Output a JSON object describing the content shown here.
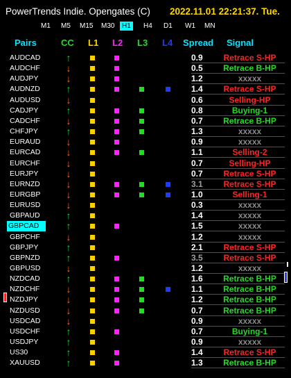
{
  "header": {
    "title": "PowerTrends Indie. Opengates (C)",
    "datetime": "2022.11.01 22:21:37. Tue."
  },
  "timeframes": [
    "M1",
    "M5",
    "M15",
    "M30",
    "H1",
    "H4",
    "D1",
    "W1",
    "MN"
  ],
  "active_timeframe": "H1",
  "columns": {
    "pairs": "Pairs",
    "cc": "CC",
    "l1": "L1",
    "l2": "L2",
    "l3": "L3",
    "l4": "L4",
    "spread": "Spread",
    "signal": "Signal"
  },
  "colors": {
    "up": "#22dd22",
    "down": "#ff6a1a",
    "l1": "#ffd000",
    "l2": "#ff22ff",
    "l3": "#22dd22",
    "l4": "#1e3cff",
    "spread": "#ffffff",
    "spread_dim": "#a0a0a0",
    "retrace_s": "#ff2222",
    "retrace_b": "#22dd22",
    "selling": "#ff2222",
    "buying": "#22dd22",
    "neutral": "#8a8a8a"
  },
  "rows": [
    {
      "pair": "AUDCAD",
      "cc": "up",
      "l1": true,
      "l2": true,
      "l3": false,
      "l4": false,
      "spread": "0.9",
      "signal": "Retrace S-HP",
      "sig": "retrace_s"
    },
    {
      "pair": "AUDCHF",
      "cc": "down",
      "l1": true,
      "l2": true,
      "l3": false,
      "l4": false,
      "spread": "0.5",
      "signal": "Retrace B-HP",
      "sig": "retrace_b"
    },
    {
      "pair": "AUDJPY",
      "cc": "down",
      "l1": true,
      "l2": true,
      "l3": false,
      "l4": false,
      "spread": "1.2",
      "signal": "xxxxx",
      "sig": "neutral"
    },
    {
      "pair": "AUDNZD",
      "cc": "up",
      "l1": true,
      "l2": true,
      "l3": true,
      "l4": true,
      "spread": "1.4",
      "signal": "Retrace S-HP",
      "sig": "retrace_s"
    },
    {
      "pair": "AUDUSD",
      "cc": "down",
      "l1": true,
      "l2": false,
      "l3": false,
      "l4": false,
      "spread": "0.6",
      "signal": "Selling-HP",
      "sig": "selling"
    },
    {
      "pair": "CADJPY",
      "cc": "up",
      "l1": true,
      "l2": true,
      "l3": true,
      "l4": false,
      "spread": "0.8",
      "signal": "Buying-1",
      "sig": "buying"
    },
    {
      "pair": "CADCHF",
      "cc": "down",
      "l1": true,
      "l2": true,
      "l3": true,
      "l4": false,
      "spread": "0.7",
      "signal": "Retrace B-HP",
      "sig": "retrace_b"
    },
    {
      "pair": "CHFJPY",
      "cc": "up",
      "l1": true,
      "l2": true,
      "l3": true,
      "l4": false,
      "spread": "1.3",
      "signal": "xxxxx",
      "sig": "neutral"
    },
    {
      "pair": "EURAUD",
      "cc": "down",
      "l1": true,
      "l2": true,
      "l3": false,
      "l4": false,
      "spread": "0.9",
      "signal": "xxxxx",
      "sig": "neutral"
    },
    {
      "pair": "EURCAD",
      "cc": "down",
      "l1": true,
      "l2": true,
      "l3": true,
      "l4": false,
      "spread": "1.1",
      "signal": "Selling-2",
      "sig": "selling"
    },
    {
      "pair": "EURCHF",
      "cc": "down",
      "l1": true,
      "l2": false,
      "l3": false,
      "l4": false,
      "spread": "0.7",
      "signal": "Selling-HP",
      "sig": "selling"
    },
    {
      "pair": "EURJPY",
      "cc": "down",
      "l1": true,
      "l2": false,
      "l3": false,
      "l4": false,
      "spread": "0.7",
      "signal": "Retrace S-HP",
      "sig": "retrace_s"
    },
    {
      "pair": "EURNZD",
      "cc": "down",
      "l1": true,
      "l2": true,
      "l3": true,
      "l4": true,
      "spread": "3.1",
      "dim": true,
      "signal": "Retrace S-HP",
      "sig": "retrace_s"
    },
    {
      "pair": "EURGBP",
      "cc": "down",
      "l1": true,
      "l2": true,
      "l3": true,
      "l4": true,
      "spread": "1.0",
      "signal": "Selling-1",
      "sig": "selling"
    },
    {
      "pair": "EURUSD",
      "cc": "down",
      "l1": true,
      "l2": false,
      "l3": false,
      "l4": false,
      "spread": "0.3",
      "signal": "xxxxx",
      "sig": "neutral"
    },
    {
      "pair": "GBPAUD",
      "cc": "up",
      "l1": true,
      "l2": false,
      "l3": false,
      "l4": false,
      "spread": "1.4",
      "signal": "xxxxx",
      "sig": "neutral"
    },
    {
      "pair": "GBPCAD",
      "cc": "up",
      "l1": true,
      "l2": true,
      "l3": false,
      "l4": false,
      "spread": "1.5",
      "signal": "xxxxx",
      "sig": "neutral",
      "hl": true
    },
    {
      "pair": "GBPCHF",
      "cc": "down",
      "l1": true,
      "l2": false,
      "l3": false,
      "l4": false,
      "spread": "1.2",
      "signal": "xxxxx",
      "sig": "neutral"
    },
    {
      "pair": "GBPJPY",
      "cc": "up",
      "l1": true,
      "l2": false,
      "l3": false,
      "l4": false,
      "spread": "2.1",
      "signal": "Retrace S-HP",
      "sig": "retrace_s"
    },
    {
      "pair": "GBPNZD",
      "cc": "up",
      "l1": true,
      "l2": true,
      "l3": false,
      "l4": false,
      "spread": "3.5",
      "dim": true,
      "signal": "Retrace S-HP",
      "sig": "retrace_s"
    },
    {
      "pair": "GBPUSD",
      "cc": "down",
      "l1": true,
      "l2": false,
      "l3": false,
      "l4": false,
      "spread": "1.2",
      "signal": "xxxxx",
      "sig": "neutral"
    },
    {
      "pair": "NZDCAD",
      "cc": "up",
      "l1": true,
      "l2": true,
      "l3": true,
      "l4": false,
      "spread": "1.6",
      "signal": "Retrace B-HP",
      "sig": "retrace_b"
    },
    {
      "pair": "NZDCHF",
      "cc": "down",
      "l1": true,
      "l2": true,
      "l3": true,
      "l4": true,
      "spread": "1.1",
      "signal": "Retrace B-HP",
      "sig": "retrace_b"
    },
    {
      "pair": "NZDJPY",
      "cc": "down",
      "l1": true,
      "l2": true,
      "l3": true,
      "l4": false,
      "spread": "1.2",
      "signal": "Retrace B-HP",
      "sig": "retrace_b"
    },
    {
      "pair": "NZDUSD",
      "cc": "down",
      "l1": true,
      "l2": true,
      "l3": true,
      "l4": false,
      "spread": "0.7",
      "signal": "Retrace B-HP",
      "sig": "retrace_b"
    },
    {
      "pair": "USDCAD",
      "cc": "down",
      "l1": true,
      "l2": false,
      "l3": false,
      "l4": false,
      "spread": "0.9",
      "signal": "xxxxx",
      "sig": "neutral"
    },
    {
      "pair": "USDCHF",
      "cc": "up",
      "l1": true,
      "l2": true,
      "l3": false,
      "l4": false,
      "spread": "0.7",
      "signal": "Buying-1",
      "sig": "buying"
    },
    {
      "pair": "USDJPY",
      "cc": "up",
      "l1": true,
      "l2": false,
      "l3": false,
      "l4": false,
      "spread": "0.9",
      "signal": "xxxxx",
      "sig": "neutral"
    },
    {
      "pair": "US30",
      "cc": "up",
      "l1": true,
      "l2": true,
      "l3": false,
      "l4": false,
      "spread": "1.4",
      "signal": "Retrace S-HP",
      "sig": "retrace_s"
    },
    {
      "pair": "XAUUSD",
      "cc": "up",
      "l1": true,
      "l2": true,
      "l3": false,
      "l4": false,
      "spread": "1.3",
      "signal": "Retrace B-HP",
      "sig": "retrace_b"
    }
  ]
}
